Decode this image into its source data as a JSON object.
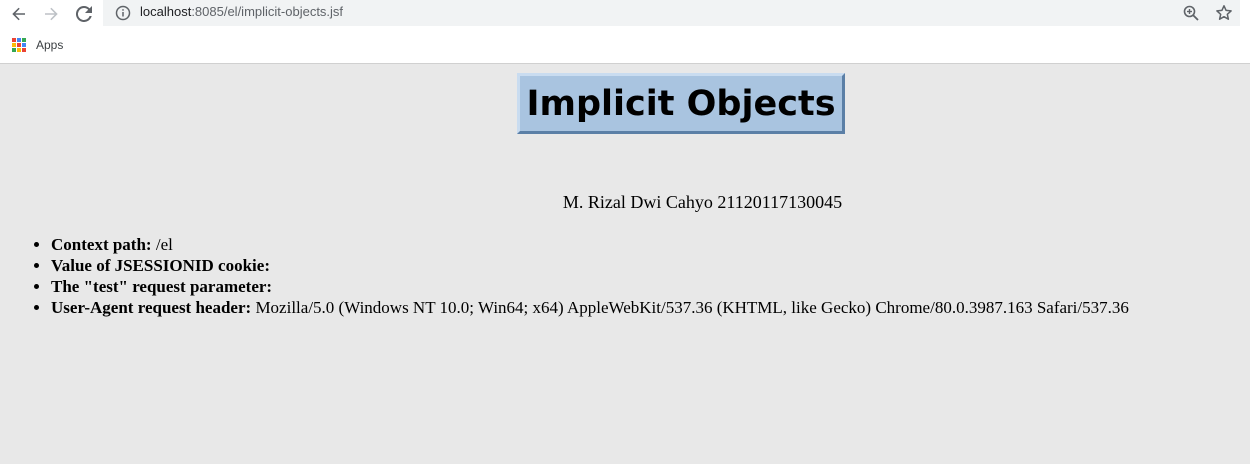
{
  "browser": {
    "url_host": "localhost",
    "url_path": ":8085/el/implicit-objects.jsf",
    "bookmarks": {
      "apps_label": "Apps"
    }
  },
  "page": {
    "heading": "Implicit Objects",
    "author": "M. Rizal Dwi Cahyo 21120117130045",
    "items": [
      {
        "label": "Context path:",
        "value": "/el"
      },
      {
        "label": "Value of JSESSIONID cookie:",
        "value": ""
      },
      {
        "label": "The \"test\" request parameter:",
        "value": ""
      },
      {
        "label": "User-Agent request header:",
        "value": "Mozilla/5.0 (Windows NT 10.0; Win64; x64) AppleWebKit/537.36 (KHTML, like Gecko) Chrome/80.0.3987.163 Safari/537.36"
      }
    ]
  },
  "icons": {
    "back": "arrow-left-icon",
    "forward": "arrow-right-icon",
    "reload": "reload-icon",
    "site_info": "info-icon",
    "zoom": "zoom-icon",
    "bookmark": "star-icon",
    "apps": "apps-grid-icon"
  },
  "colors": {
    "page_background": "#e8e8e8",
    "heading_background": "#a9c4e0",
    "heading_border_dark": "#5b7fa6"
  }
}
